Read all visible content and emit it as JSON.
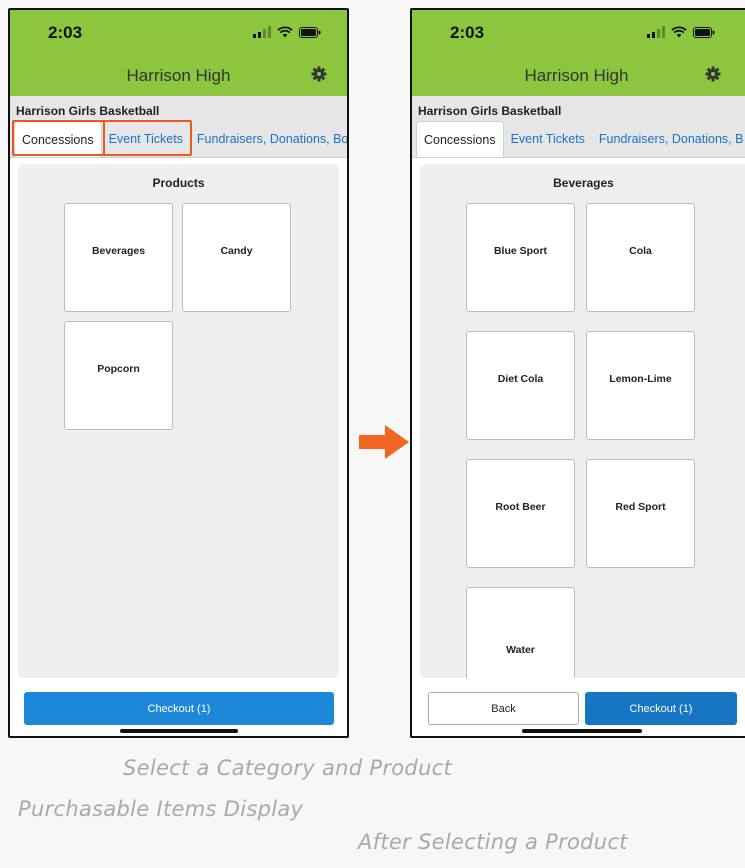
{
  "left_screen": {
    "status_time": "2:03",
    "header_title": "Harrison High",
    "team_name": "Harrison Girls Basketball",
    "tabs": [
      "Concessions",
      "Event Tickets",
      "Fundraisers, Donations, Bo"
    ],
    "active_tab": "Concessions",
    "section_title": "Products",
    "tiles": [
      "Beverages",
      "Candy",
      "Popcorn"
    ],
    "checkout_label": "Checkout (1)"
  },
  "right_screen": {
    "status_time": "2:03",
    "header_title": "Harrison High",
    "team_name": "Harrison Girls Basketball",
    "tabs": [
      "Concessions",
      "Event Tickets",
      "Fundraisers, Donations, B"
    ],
    "active_tab": "Concessions",
    "section_title": "Beverages",
    "tiles": [
      "Blue Sport",
      "Cola",
      "Diet Cola",
      "Lemon-Lime",
      "Root Beer",
      "Red Sport",
      "Water"
    ],
    "back_label": "Back",
    "checkout_label": "Checkout (1)"
  },
  "captions": {
    "select_category": "Select a Category and Product",
    "items_display": "Purchasable Items Display",
    "after_selecting": "After Selecting a Product"
  },
  "colors": {
    "header_green": "#8cc63f",
    "primary_blue": "#1e88d8",
    "highlight_orange": "#e85a20",
    "arrow_orange": "#f26522"
  },
  "icons": [
    "gear-icon",
    "signal-icon",
    "wifi-icon",
    "battery-icon",
    "right-arrow-icon"
  ]
}
